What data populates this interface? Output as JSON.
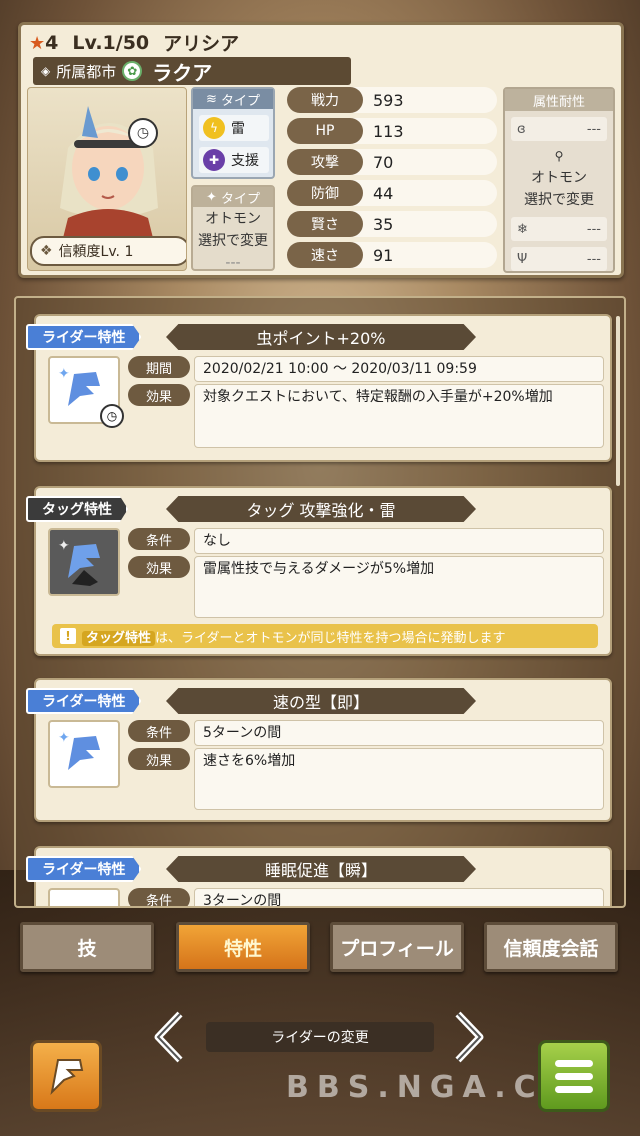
{
  "header": {
    "rarity": "4",
    "level": "Lv.1/50",
    "name": "アリシア",
    "city_label": "所属都市",
    "city_name": "ラクア",
    "trust": "信頼度Lv. 1"
  },
  "type": {
    "header": "タイプ",
    "element": "雷",
    "role": "支援",
    "otomon_header": "タイプ",
    "otomon_text1": "オトモン",
    "otomon_text2": "選択で変更",
    "otomon_value": "---"
  },
  "stats": [
    {
      "label": "戦力",
      "value": "593"
    },
    {
      "label": "HP",
      "value": "113"
    },
    {
      "label": "攻撃",
      "value": "70"
    },
    {
      "label": "防御",
      "value": "44"
    },
    {
      "label": "賢さ",
      "value": "35"
    },
    {
      "label": "速さ",
      "value": "91"
    }
  ],
  "resist": {
    "header": "属性耐性",
    "r1": "---",
    "mid1": "オトモン",
    "mid2": "選択で変更",
    "r2": "---",
    "r3": "---"
  },
  "cards": [
    {
      "tag": "ライダー特性",
      "title": "虫ポイント+20%",
      "label1": "期間",
      "value1": "2020/02/21 10:00 ～ 2020/03/11 09:59",
      "label2": "効果",
      "value2": "対象クエストにおいて、特定報酬の入手量が+20%増加"
    },
    {
      "tag": "タッグ特性",
      "title": "タッグ 攻撃強化・雷",
      "label1": "条件",
      "value1": "なし",
      "label2": "効果",
      "value2": "雷属性技で与えるダメージが5%増加",
      "note_mark": "!",
      "note_bold": "タッグ特性",
      "note_rest": "は、ライダーとオトモンが同じ特性を持つ場合に発動します"
    },
    {
      "tag": "ライダー特性",
      "title": "速の型【即】",
      "label1": "条件",
      "value1": "5ターンの間",
      "label2": "効果",
      "value2": "速さを6%増加"
    },
    {
      "tag": "ライダー特性",
      "title": "睡眠促進【瞬】",
      "label1": "条件",
      "value1": "3ターンの間"
    }
  ],
  "tabs": [
    "技",
    "特性",
    "プロフィール",
    "信頼度会話"
  ],
  "active_tab": "特性",
  "footer": {
    "change_rider": "ライダーの変更",
    "watermark": "BBS.NGA.CN"
  },
  "colors": {
    "rider_tag": "#4a7fd6",
    "tag_tag": "#3b3b3b",
    "active_tab": "#f1a437",
    "menu_button": "#7fb336"
  }
}
